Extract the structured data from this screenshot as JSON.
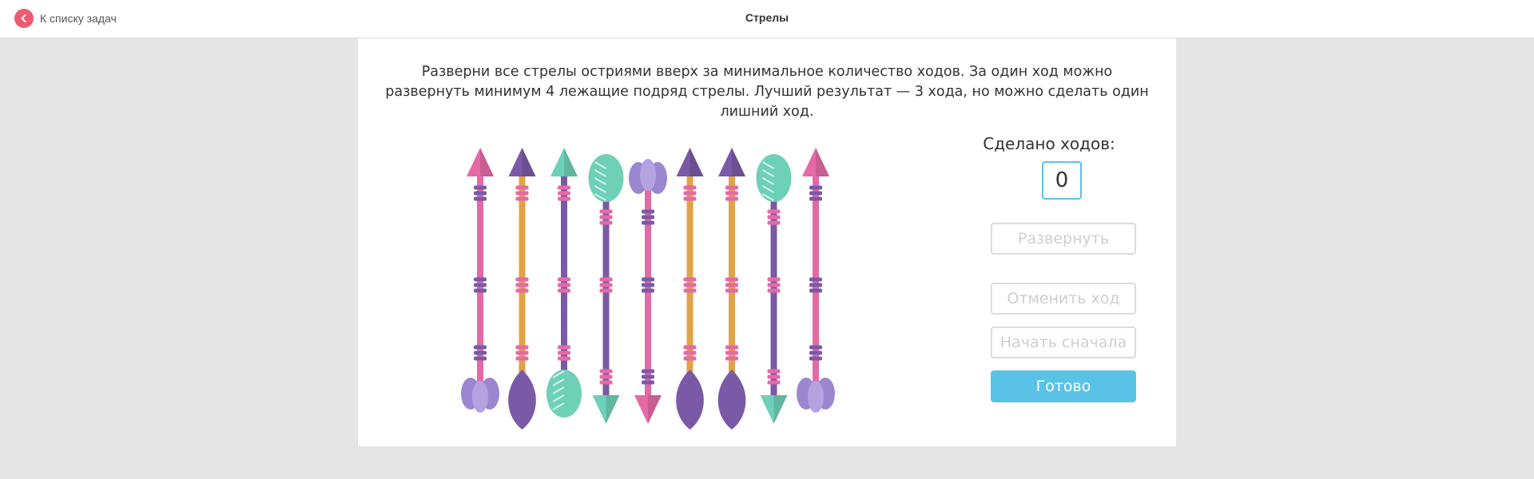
{
  "header": {
    "back_label": "К списку задач",
    "title": "Стрелы"
  },
  "task": {
    "instructions": "Разверни все стрелы остриями вверх за минимальное количество ходов. За один ход можно развернуть минимум 4 лежащие подряд стрелы. Лучший результат — 3 хода, но можно сделать один лишний ход."
  },
  "arrows": [
    {
      "shaft_color": "#e46aa6",
      "head": "up",
      "style": "pink"
    },
    {
      "shaft_color": "#e0a347",
      "head": "up",
      "style": "purple"
    },
    {
      "shaft_color": "#7a5aa6",
      "head": "up",
      "style": "teal"
    },
    {
      "shaft_color": "#7a5aa6",
      "head": "down",
      "style": "teal"
    },
    {
      "shaft_color": "#e46aa6",
      "head": "down",
      "style": "pink"
    },
    {
      "shaft_color": "#e0a347",
      "head": "up",
      "style": "purple"
    },
    {
      "shaft_color": "#e0a347",
      "head": "up",
      "style": "purple"
    },
    {
      "shaft_color": "#7a5aa6",
      "head": "down",
      "style": "teal"
    },
    {
      "shaft_color": "#e46aa6",
      "head": "up",
      "style": "pink"
    }
  ],
  "panel": {
    "moves_label": "Сделано ходов:",
    "moves_count": "0",
    "rotate_label": "Развернуть",
    "undo_label": "Отменить ход",
    "restart_label": "Начать сначала",
    "done_label": "Готово"
  },
  "colors": {
    "accent": "#5bc2e7",
    "back_icon": "#ef5a6f",
    "pink": "#e46aa6",
    "purple": "#7a5aa6",
    "lavender": "#9b86d0",
    "teal": "#6fd0b8",
    "gold": "#e0a347"
  }
}
